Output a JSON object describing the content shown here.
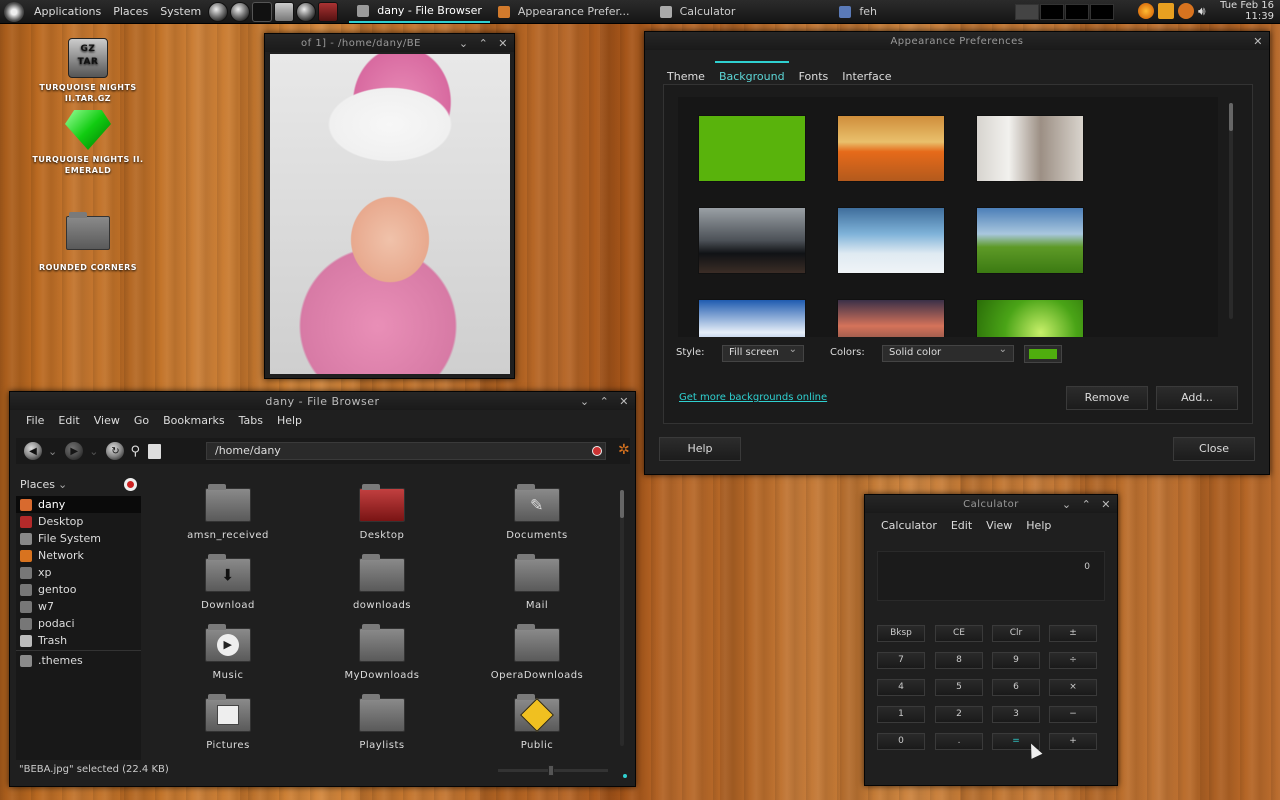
{
  "panel": {
    "applications": "Applications",
    "places": "Places",
    "system": "System",
    "tasks": [
      {
        "label": "dany - File Browser",
        "active": true
      },
      {
        "label": "Appearance Prefer...",
        "active": false
      },
      {
        "label": "Calculator",
        "active": false
      },
      {
        "label": "feh",
        "active": false
      }
    ],
    "clock_day": "Tue Feb 16",
    "clock_time": "11:39"
  },
  "desktop": {
    "icons": [
      {
        "label1": "TURQUOISE NIGHTS II.TAR.GZ",
        "label2": ""
      },
      {
        "label1": "TURQUOISE NIGHTS II.",
        "label2": "EMERALD"
      },
      {
        "label1": "ROUNDED CORNERS",
        "label2": ""
      }
    ],
    "gz_text": "GZ",
    "tar_text": "TAR"
  },
  "viewer": {
    "title": "of 1] - /home/dany/BE"
  },
  "filebrowser": {
    "title": "dany - File Browser",
    "menu": [
      "File",
      "Edit",
      "View",
      "Go",
      "Bookmarks",
      "Tabs",
      "Help"
    ],
    "path": "/home/dany",
    "places_label": "Places",
    "places": [
      "dany",
      "Desktop",
      "File System",
      "Network",
      "xp",
      "gentoo",
      "w7",
      "podaci",
      "Trash"
    ],
    "bookmark": ".themes",
    "files": [
      "amsn_received",
      "Desktop",
      "Documents",
      "Download",
      "downloads",
      "Mail",
      "Music",
      "MyDownloads",
      "OperaDownloads",
      "Pictures",
      "Playlists",
      "Public"
    ],
    "status": "\"BEBA.jpg\" selected (22.4 KB)"
  },
  "appearance": {
    "title": "Appearance Preferences",
    "tabs": [
      "Theme",
      "Background",
      "Fonts",
      "Interface"
    ],
    "style_label": "Style:",
    "style_value": "Fill screen",
    "colors_label": "Colors:",
    "colors_value": "Solid color",
    "color_swatch": "#4fae0e",
    "link": "Get more backgrounds online",
    "remove": "Remove",
    "add": "Add...",
    "help": "Help",
    "close": "Close"
  },
  "calculator": {
    "title": "Calculator",
    "menu": [
      "Calculator",
      "Edit",
      "View",
      "Help"
    ],
    "display": "0",
    "rows": [
      [
        "Bksp",
        "CE",
        "Clr",
        "±"
      ],
      [
        "7",
        "8",
        "9",
        "÷"
      ],
      [
        "4",
        "5",
        "6",
        "×"
      ],
      [
        "1",
        "2",
        "3",
        "−"
      ],
      [
        "0",
        ".",
        "=",
        "+"
      ]
    ]
  },
  "colors": {
    "accent": "#2fd0d0",
    "window_bg": "#1f1f1f"
  }
}
